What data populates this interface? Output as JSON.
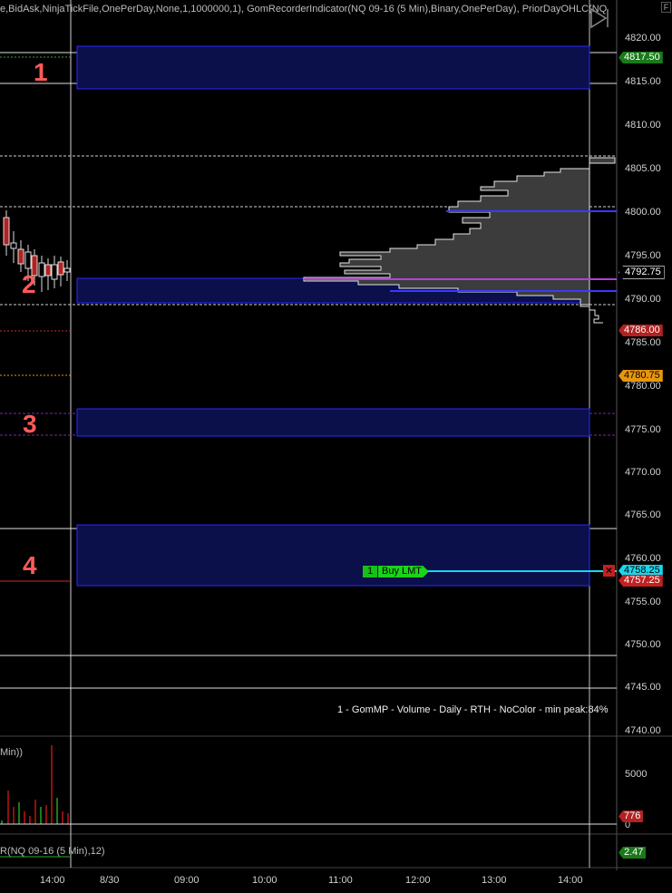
{
  "header": {
    "title": "e,BidAsk,NinjaTickFile,OnePerDay,None,1,1000000,1), GomRecorderIndicator(NQ 09-16 (5 Min),Binary,OnePerDay), PriorDayOHLC(NQ",
    "corner_badge": "F"
  },
  "price_axis": {
    "ticks": [
      "4820.00",
      "4815.00",
      "4810.00",
      "4805.00",
      "4800.00",
      "4795.00",
      "4790.00",
      "4785.00",
      "4780.00",
      "4775.00",
      "4770.00",
      "4765.00",
      "4760.00",
      "4755.00",
      "4750.00",
      "4745.00",
      "4740.00"
    ]
  },
  "price_tags": [
    {
      "label": "4817.50",
      "bg": "#1a7a1a",
      "color": "#ffffff"
    },
    {
      "label": "4792.75",
      "bg": "#000000",
      "color": "#ffffff"
    },
    {
      "label": "4786.00",
      "bg": "#b22222",
      "color": "#ffffff"
    },
    {
      "label": "4780.75",
      "bg": "#e8960c",
      "color": "#000000"
    },
    {
      "label": "4758.25",
      "bg": "#19d6ee",
      "color": "#000000"
    },
    {
      "label": "4757.25",
      "bg": "#c42020",
      "color": "#ffffff"
    }
  ],
  "zones": [
    {
      "number": "1"
    },
    {
      "number": "2"
    },
    {
      "number": "3"
    },
    {
      "number": "4"
    }
  ],
  "order": {
    "quantity": "1",
    "type": "Buy LMT",
    "cancel_icon": "×"
  },
  "profile_caption": "1 - GomMP  - Volume - Daily - RTH - NoColor - min peak:84%",
  "volume_panel": {
    "label": "Min))",
    "ticks": [
      "5000",
      "0"
    ],
    "tag": {
      "label": "776",
      "bg": "#b22222",
      "color": "#ffffff"
    }
  },
  "indicator_panel": {
    "label": "R(NQ 09-16 (5 Min),12)",
    "tag": {
      "label": "2.47",
      "bg": "#1a7a1a",
      "color": "#ffffff"
    }
  },
  "time_axis": {
    "ticks": [
      "14:00",
      "8/30",
      "09:00",
      "10:00",
      "11:00",
      "12:00",
      "13:00",
      "14:00"
    ]
  },
  "colors": {
    "background": "#000000",
    "zone_fill": "#0b0f4a",
    "zone_border": "#2a2aff",
    "profile_fill": "#3c3c3c",
    "poc_line": "#9b30c8",
    "limit_line": "#19d6ee"
  }
}
